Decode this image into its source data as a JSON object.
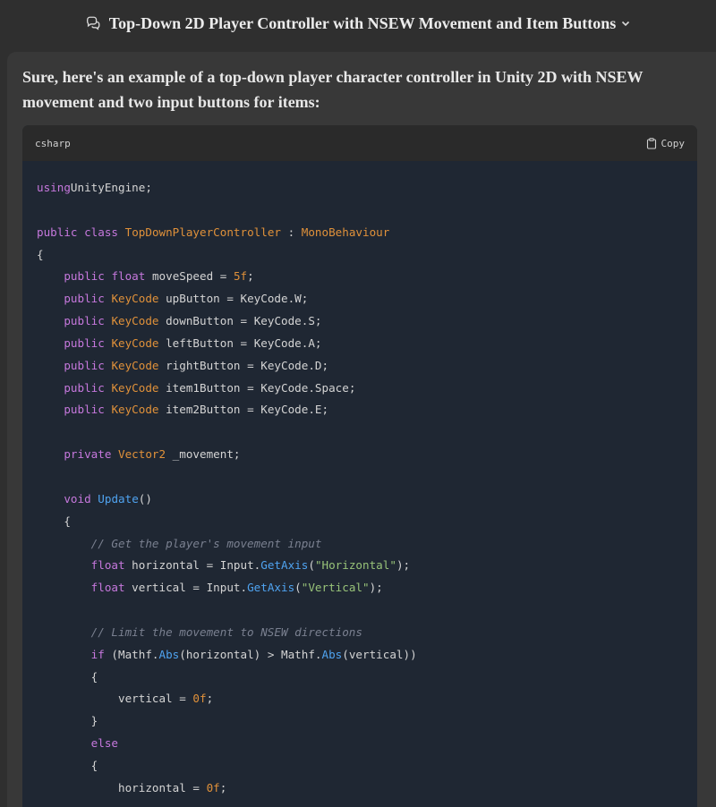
{
  "header": {
    "title": "Top-Down 2D Player Controller with NSEW Movement and Item Buttons"
  },
  "message": {
    "intro": "Sure, here's an example of a top-down player character controller in Unity 2D with NSEW movement and two input buttons for items:"
  },
  "code_block": {
    "language": "csharp",
    "copy_label": "Copy",
    "lines": [
      [
        [
          "kw",
          "using"
        ],
        [
          "",
          "UnityEngine;"
        ]
      ],
      [],
      [
        [
          "kw",
          "public"
        ],
        [
          "",
          " "
        ],
        [
          "kw",
          "class"
        ],
        [
          "",
          " "
        ],
        [
          "ty",
          "TopDownPlayerController"
        ],
        [
          "op",
          " : "
        ],
        [
          "ty",
          "MonoBehaviour"
        ]
      ],
      [
        [
          "",
          "{"
        ]
      ],
      [
        [
          "",
          "    "
        ],
        [
          "kw",
          "public"
        ],
        [
          "",
          " "
        ],
        [
          "kw",
          "float"
        ],
        [
          "",
          " moveSpeed "
        ],
        [
          "op",
          "="
        ],
        [
          "",
          " "
        ],
        [
          "num",
          "5f"
        ],
        [
          "",
          ";"
        ]
      ],
      [
        [
          "",
          "    "
        ],
        [
          "kw",
          "public"
        ],
        [
          "",
          " "
        ],
        [
          "ty",
          "KeyCode"
        ],
        [
          "",
          " upButton "
        ],
        [
          "op",
          "="
        ],
        [
          "",
          " KeyCode.W;"
        ]
      ],
      [
        [
          "",
          "    "
        ],
        [
          "kw",
          "public"
        ],
        [
          "",
          " "
        ],
        [
          "ty",
          "KeyCode"
        ],
        [
          "",
          " downButton "
        ],
        [
          "op",
          "="
        ],
        [
          "",
          " KeyCode.S;"
        ]
      ],
      [
        [
          "",
          "    "
        ],
        [
          "kw",
          "public"
        ],
        [
          "",
          " "
        ],
        [
          "ty",
          "KeyCode"
        ],
        [
          "",
          " leftButton "
        ],
        [
          "op",
          "="
        ],
        [
          "",
          " KeyCode.A;"
        ]
      ],
      [
        [
          "",
          "    "
        ],
        [
          "kw",
          "public"
        ],
        [
          "",
          " "
        ],
        [
          "ty",
          "KeyCode"
        ],
        [
          "",
          " rightButton "
        ],
        [
          "op",
          "="
        ],
        [
          "",
          " KeyCode.D;"
        ]
      ],
      [
        [
          "",
          "    "
        ],
        [
          "kw",
          "public"
        ],
        [
          "",
          " "
        ],
        [
          "ty",
          "KeyCode"
        ],
        [
          "",
          " item1Button "
        ],
        [
          "op",
          "="
        ],
        [
          "",
          " KeyCode.Space;"
        ]
      ],
      [
        [
          "",
          "    "
        ],
        [
          "kw",
          "public"
        ],
        [
          "",
          " "
        ],
        [
          "ty",
          "KeyCode"
        ],
        [
          "",
          " item2Button "
        ],
        [
          "op",
          "="
        ],
        [
          "",
          " KeyCode.E;"
        ]
      ],
      [],
      [
        [
          "",
          "    "
        ],
        [
          "kw",
          "private"
        ],
        [
          "",
          " "
        ],
        [
          "ty",
          "Vector2"
        ],
        [
          "",
          " _movement;"
        ]
      ],
      [],
      [
        [
          "",
          "    "
        ],
        [
          "kw",
          "void"
        ],
        [
          "",
          " "
        ],
        [
          "fn",
          "Update"
        ],
        [
          "",
          "()"
        ]
      ],
      [
        [
          "",
          "    {"
        ]
      ],
      [
        [
          "",
          "        "
        ],
        [
          "cm",
          "// Get the player's movement input"
        ]
      ],
      [
        [
          "",
          "        "
        ],
        [
          "kw",
          "float"
        ],
        [
          "",
          " horizontal "
        ],
        [
          "op",
          "="
        ],
        [
          "",
          " Input."
        ],
        [
          "fn",
          "GetAxis"
        ],
        [
          "",
          "("
        ],
        [
          "str",
          "\"Horizontal\""
        ],
        [
          "",
          ");"
        ]
      ],
      [
        [
          "",
          "        "
        ],
        [
          "kw",
          "float"
        ],
        [
          "",
          " vertical "
        ],
        [
          "op",
          "="
        ],
        [
          "",
          " Input."
        ],
        [
          "fn",
          "GetAxis"
        ],
        [
          "",
          "("
        ],
        [
          "str",
          "\"Vertical\""
        ],
        [
          "",
          ");"
        ]
      ],
      [],
      [
        [
          "",
          "        "
        ],
        [
          "cm",
          "// Limit the movement to NSEW directions"
        ]
      ],
      [
        [
          "",
          "        "
        ],
        [
          "kw",
          "if"
        ],
        [
          "",
          " (Mathf."
        ],
        [
          "fn",
          "Abs"
        ],
        [
          "",
          "(horizontal) "
        ],
        [
          "op",
          ">"
        ],
        [
          "",
          " Mathf."
        ],
        [
          "fn",
          "Abs"
        ],
        [
          "",
          "(vertical))"
        ]
      ],
      [
        [
          "",
          "        {"
        ]
      ],
      [
        [
          "",
          "            vertical "
        ],
        [
          "op",
          "="
        ],
        [
          "",
          " "
        ],
        [
          "num",
          "0f"
        ],
        [
          "",
          ";"
        ]
      ],
      [
        [
          "",
          "        }"
        ]
      ],
      [
        [
          "",
          "        "
        ],
        [
          "kw",
          "else"
        ]
      ],
      [
        [
          "",
          "        {"
        ]
      ],
      [
        [
          "",
          "            horizontal "
        ],
        [
          "op",
          "="
        ],
        [
          "",
          " "
        ],
        [
          "num",
          "0f"
        ],
        [
          "",
          ";"
        ]
      ]
    ]
  }
}
